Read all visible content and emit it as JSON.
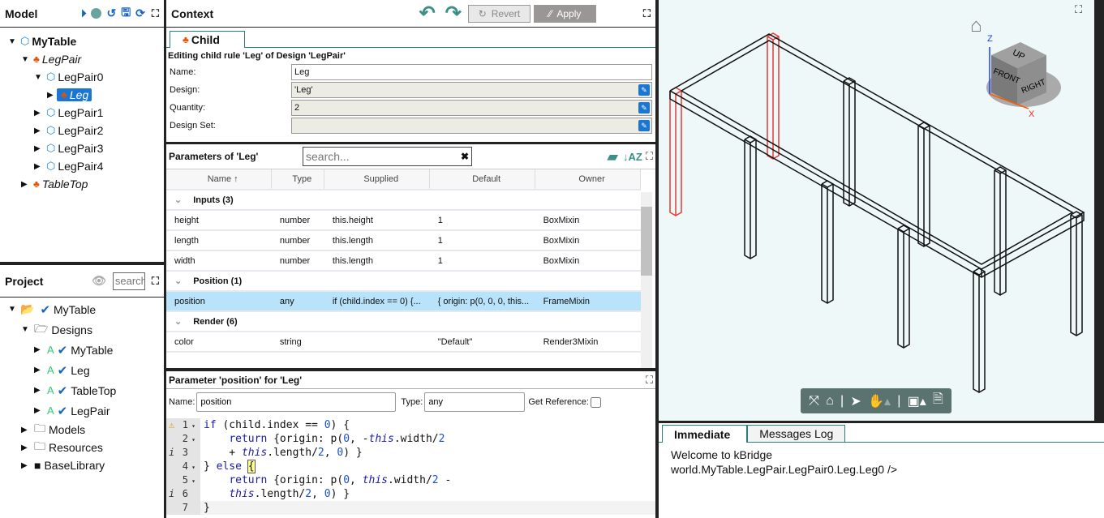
{
  "model": {
    "title": "Model",
    "tree": [
      {
        "label": "MyTable",
        "level": 0,
        "icon": "cube-icon",
        "open": true,
        "bold": true
      },
      {
        "label": "LegPair",
        "level": 1,
        "icon": "hierarchy-icon",
        "open": true,
        "italic": true
      },
      {
        "label": "LegPair0",
        "level": 2,
        "icon": "cube-icon",
        "open": true
      },
      {
        "label": "Leg",
        "level": 3,
        "icon": "hierarchy-icon",
        "open": false,
        "italic": true,
        "selected": true
      },
      {
        "label": "LegPair1",
        "level": 2,
        "icon": "cube-icon",
        "open": false
      },
      {
        "label": "LegPair2",
        "level": 2,
        "icon": "cube-icon",
        "open": false
      },
      {
        "label": "LegPair3",
        "level": 2,
        "icon": "cube-icon",
        "open": false
      },
      {
        "label": "LegPair4",
        "level": 2,
        "icon": "cube-icon",
        "open": false
      },
      {
        "label": "TableTop",
        "level": 1,
        "icon": "hierarchy-icon",
        "open": false,
        "italic": true
      }
    ]
  },
  "project": {
    "title": "Project",
    "search_placeholder": "search",
    "tree": [
      {
        "label": "MyTable",
        "level": 0,
        "open": true,
        "type": "project"
      },
      {
        "label": "Designs",
        "level": 1,
        "open": true,
        "type": "folder-open"
      },
      {
        "label": "MyTable",
        "level": 2,
        "type": "design"
      },
      {
        "label": "Leg",
        "level": 2,
        "type": "design"
      },
      {
        "label": "TableTop",
        "level": 2,
        "type": "design"
      },
      {
        "label": "LegPair",
        "level": 2,
        "type": "design"
      },
      {
        "label": "Models",
        "level": 1,
        "type": "folder"
      },
      {
        "label": "Resources",
        "level": 1,
        "type": "folder"
      },
      {
        "label": "BaseLibrary",
        "level": 1,
        "type": "folder-solid"
      }
    ]
  },
  "context": {
    "title": "Context",
    "revert": "Revert",
    "apply": "Apply",
    "tab": "Child",
    "heading": "Editing child rule 'Leg' of Design 'LegPair'",
    "fields": [
      {
        "label": "Name:",
        "value": "Leg",
        "editable": true
      },
      {
        "label": "Design:",
        "value": "'Leg'"
      },
      {
        "label": "Quantity:",
        "value": "2"
      },
      {
        "label": "Design Set:",
        "value": ""
      }
    ]
  },
  "params": {
    "title": "Parameters of 'Leg'",
    "search_placeholder": "search...",
    "columns": [
      "Name ↑",
      "Type",
      "Supplied",
      "Default",
      "Owner"
    ],
    "rows": [
      {
        "group": "Inputs (3)"
      },
      {
        "cells": [
          "height",
          "number",
          "this.height",
          "1",
          "BoxMixin"
        ]
      },
      {
        "cells": [
          "length",
          "number",
          "this.length",
          "1",
          "BoxMixin"
        ]
      },
      {
        "cells": [
          "width",
          "number",
          "this.length",
          "1",
          "BoxMixin"
        ]
      },
      {
        "group": "Position (1)"
      },
      {
        "cells": [
          "position",
          "any",
          "if (child.index == 0) {...",
          "{ origin: p(0, 0, 0, this...",
          "FrameMixin"
        ],
        "selected": true
      },
      {
        "group": "Render (6)"
      },
      {
        "cells": [
          "color",
          "string",
          "",
          "\"Default\"",
          "Render3Mixin"
        ]
      }
    ]
  },
  "param_editor": {
    "title": "Parameter 'position' for 'Leg'",
    "name_label": "Name:",
    "name_value": "position",
    "type_label": "Type:",
    "type_value": "any",
    "ref_label": "Get Reference:",
    "lines": [
      {
        "n": "1",
        "mark": "warning",
        "fold": true
      },
      {
        "n": "2",
        "fold": true
      },
      {
        "n": "3",
        "mark": "info"
      },
      {
        "n": "4",
        "fold": true
      },
      {
        "n": "5",
        "fold": true
      },
      {
        "n": "6",
        "mark": "info"
      },
      {
        "n": "7"
      }
    ]
  },
  "viewer": {
    "cube_faces": [
      "UP",
      "FRONT",
      "RIGHT"
    ],
    "axes": [
      "Z",
      "X"
    ],
    "highlight_color": "#e53935"
  },
  "console": {
    "tabs": [
      "Immediate",
      "Messages Log"
    ],
    "lines": [
      "Welcome to kBridge",
      "world.MyTable.LegPair.LegPair0.Leg.Leg0 />"
    ]
  }
}
